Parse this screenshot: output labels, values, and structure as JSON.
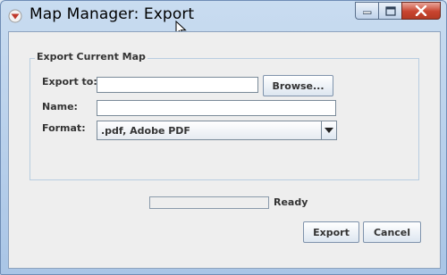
{
  "window": {
    "title": "Map Manager: Export",
    "buttons": {
      "minimize": "minimize",
      "maximize": "maximize",
      "close": "close"
    }
  },
  "group": {
    "title": "Export Current Map",
    "export_to": {
      "label": "Export to:",
      "value": "",
      "browse_label": "Browse..."
    },
    "name": {
      "label": "Name:",
      "value": ""
    },
    "format": {
      "label": "Format:",
      "selected": ".pdf, Adobe PDF"
    }
  },
  "progress": {
    "fraction": 0
  },
  "status_text": "Ready",
  "footer": {
    "export_label": "Export",
    "cancel_label": "Cancel"
  },
  "colors": {
    "close_button": "#c8442f",
    "app_icon": "#c0392b"
  }
}
